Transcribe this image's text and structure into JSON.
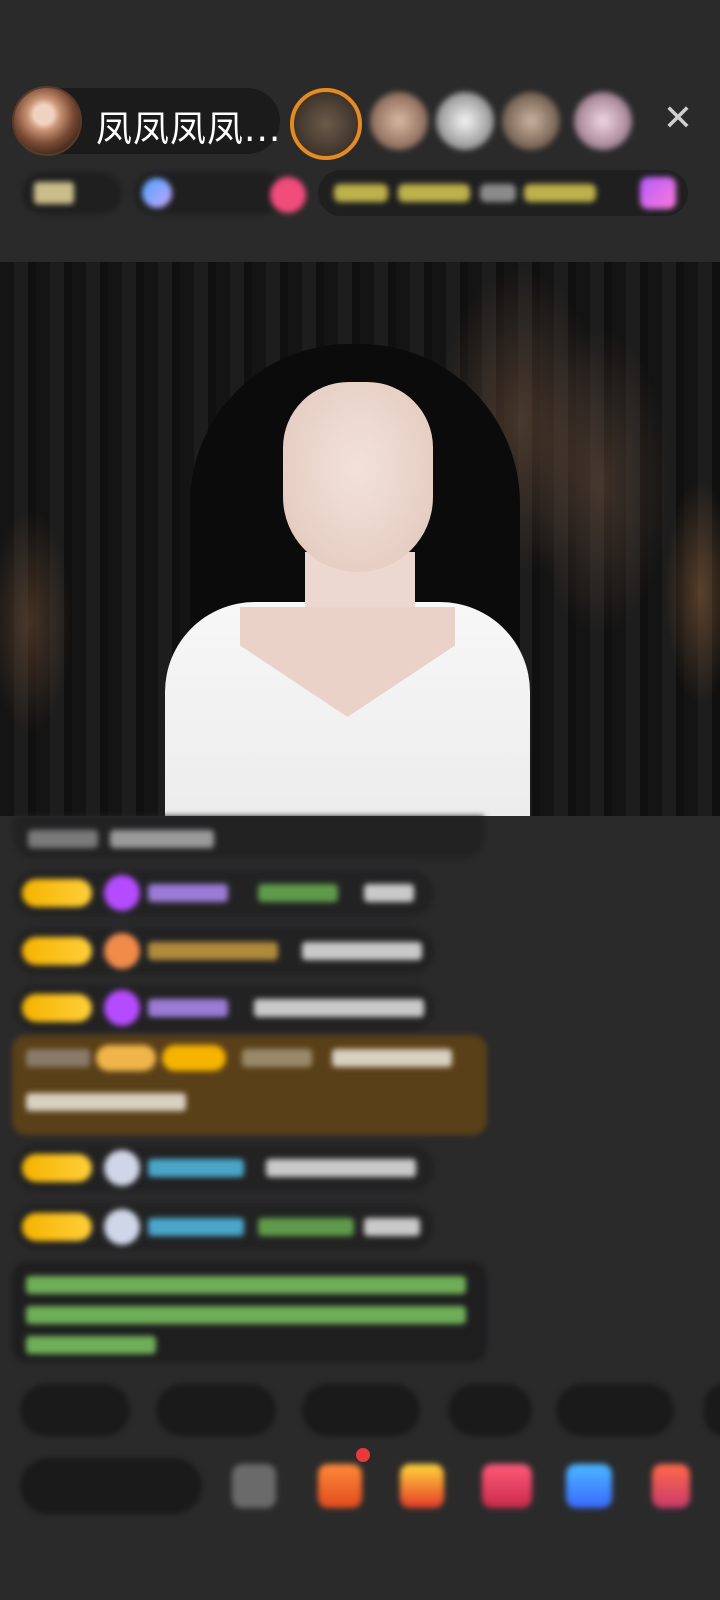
{
  "host": {
    "name": "凤凤凤凤..."
  },
  "colors": {
    "background": "#2a2a2b",
    "badge_gold": "#f6b300",
    "highlight_bg": "#5a4018",
    "accent_pink": "#f14c7c"
  },
  "icons": {
    "close": "close-icon",
    "gift": "gift-icon",
    "more": "more-icon"
  }
}
